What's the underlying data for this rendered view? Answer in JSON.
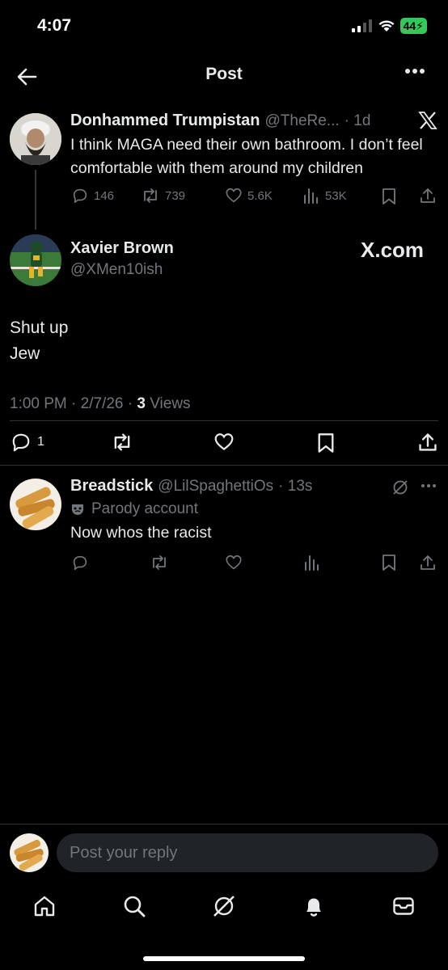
{
  "status_bar": {
    "time": "4:07",
    "battery": "44"
  },
  "header": {
    "title": "Post"
  },
  "parent_tweet": {
    "name": "Donhammed Trumpistan",
    "handle": "@TheRe...",
    "time": "· 1d",
    "text": "I think MAGA need their own bathroom. I don’t feel comfortable with them around my children",
    "replies": "146",
    "reposts": "739",
    "likes": "5.6K",
    "views": "53K"
  },
  "main_tweet": {
    "name": "Xavier Brown",
    "handle": "@XMen10ish",
    "watermark": "X.com",
    "text_line1": "Shut up",
    "text_line2": "Jew",
    "time": "1:00 PM · 2/7/26 · ",
    "views_count": "3",
    "views_label": " Views",
    "replies": "1"
  },
  "reply": {
    "name": "Breadstick",
    "handle": "@LilSpaghettiOs",
    "time": "· 13s",
    "parody_label": "Parody account",
    "text": "Now whos the racist"
  },
  "composer": {
    "placeholder": "Post your reply"
  },
  "colors": {
    "background": "#000000",
    "text": "#e7e9ea",
    "muted": "#71767b",
    "divider": "#2f3336",
    "battery": "#34c759"
  }
}
